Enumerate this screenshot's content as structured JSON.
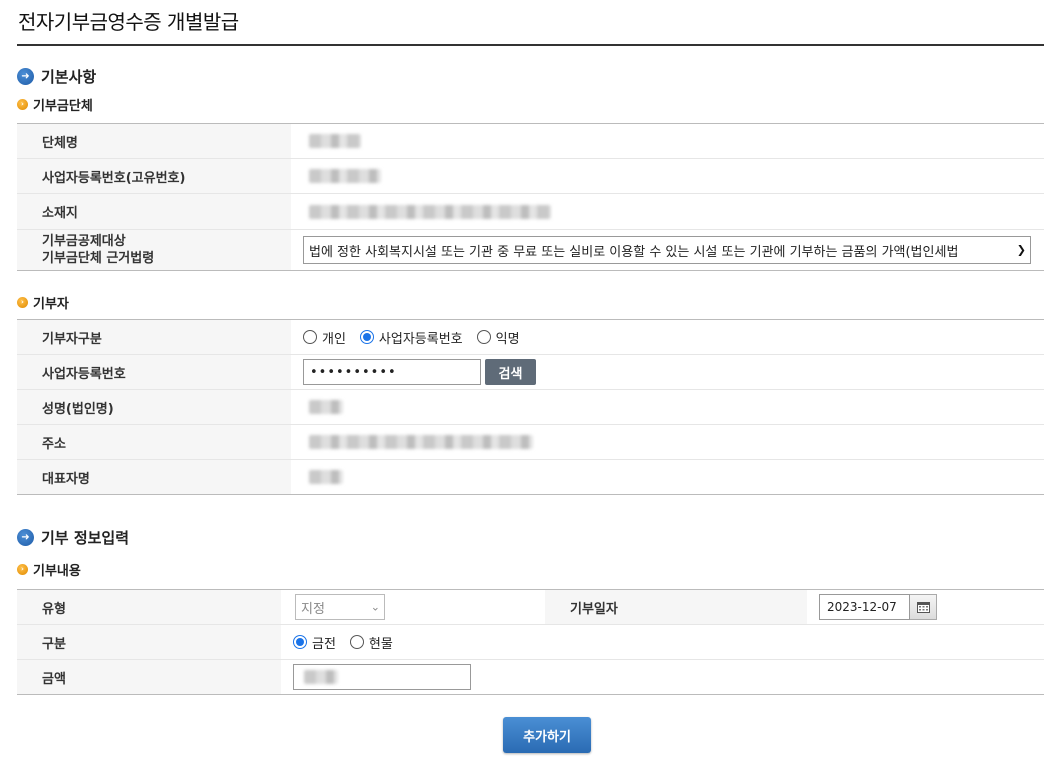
{
  "page": {
    "title": "전자기부금영수증 개별발급"
  },
  "sections": {
    "basic": "기본사항",
    "donation_info": "기부 정보입력"
  },
  "subsections": {
    "org": "기부금단체",
    "donor": "기부자",
    "content": "기부내용"
  },
  "org": {
    "name_label": "단체명",
    "reg_label": "사업자등록번호(고유번호)",
    "addr_label": "소재지",
    "law_label_line1": "기부금공제대상",
    "law_label_line2": "기부금단체 근거법령",
    "law_value": "법에 정한 사회복지시설 또는 기관 중 무료 또는 실비로 이용할 수 있는 시설 또는 기관에 기부하는 금품의 가액(법인세법"
  },
  "donor": {
    "type_label": "기부자구분",
    "type_options": [
      "개인",
      "사업자등록번호",
      "익명"
    ],
    "type_selected": "사업자등록번호",
    "reg_label": "사업자등록번호",
    "reg_value": "••••••••••",
    "search_button": "검색",
    "name_label": "성명(법인명)",
    "addr_label": "주소",
    "rep_label": "대표자명"
  },
  "content": {
    "type_label": "유형",
    "type_value": "지정",
    "date_label": "기부일자",
    "date_value": "2023-12-07",
    "kind_label": "구분",
    "kind_options": [
      "금전",
      "현물"
    ],
    "kind_selected": "금전",
    "amount_label": "금액"
  },
  "actions": {
    "add_button": "추가하기"
  },
  "colors": {
    "accent": "#2a6bb3",
    "search_button": "#5f6b78",
    "label_bg": "#f6f6f6"
  }
}
